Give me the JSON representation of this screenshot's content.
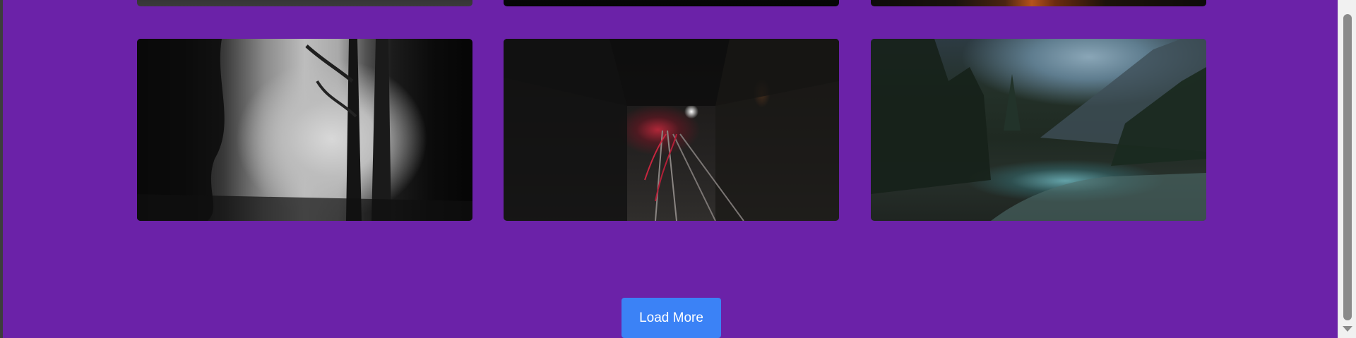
{
  "gallery": {
    "previous_row": [
      {
        "icon": "dark-image"
      },
      {
        "icon": "black-image"
      },
      {
        "icon": "fire-image"
      }
    ],
    "current_row": [
      {
        "icon": "foggy-forest-image"
      },
      {
        "icon": "train-tunnel-image"
      },
      {
        "icon": "mountain-river-image"
      }
    ]
  },
  "load_more": {
    "label": "Load More",
    "color": "#3b82f6"
  },
  "colors": {
    "background": "#6b22a8"
  }
}
